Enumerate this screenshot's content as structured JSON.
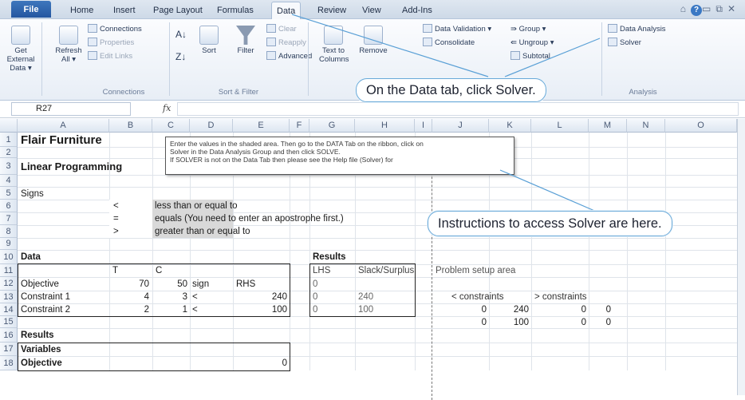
{
  "tabs": [
    "File",
    "Home",
    "Insert",
    "Page Layout",
    "Formulas",
    "Data",
    "Review",
    "View",
    "Add-Ins"
  ],
  "active_tab": "Data",
  "ribbon": {
    "get_external_data": "Get External Data ▾",
    "refresh_all": "Refresh All ▾",
    "connections": "Connections",
    "properties": "Properties",
    "edit_links": "Edit Links",
    "group_connections": "Connections",
    "sort": "Sort",
    "filter": "Filter",
    "clear": "Clear",
    "reapply": "Reapply",
    "advanced": "Advanced",
    "group_sort_filter": "Sort & Filter",
    "text_to_columns": "Text to Columns",
    "remove_duplicates": "Remove",
    "data_validation": "Data Validation ▾",
    "consolidate": "Consolidate",
    "group": "Group ▾",
    "ungroup": "Ungroup ▾",
    "subtotal": "Subtotal",
    "data_analysis": "Data Analysis",
    "solver": "Solver",
    "group_analysis": "Analysis"
  },
  "callouts": {
    "data_tab": "On the Data tab, click Solver.",
    "instructions": "Instructions to access Solver are here."
  },
  "formula_bar": {
    "name_box": "R27",
    "fx": "fx",
    "value": ""
  },
  "columns": [
    "A",
    "B",
    "C",
    "D",
    "E",
    "F",
    "G",
    "H",
    "I",
    "J",
    "K",
    "L",
    "M",
    "N",
    "O"
  ],
  "rows": [
    "1",
    "2",
    "3",
    "4",
    "5",
    "6",
    "7",
    "8",
    "9",
    "10",
    "11",
    "12",
    "13",
    "14",
    "15",
    "16",
    "17",
    "18"
  ],
  "sheet": {
    "title": "Flair Furniture",
    "subtitle": "Linear Programming",
    "signs": "Signs",
    "sign_lt": "<",
    "sign_eq": "=",
    "sign_gt": ">",
    "desc_lt": "less than or equal to",
    "desc_eq": "equals (You need to enter an apostrophe first.)",
    "desc_gt": "greater than or equal to",
    "data": "Data",
    "hdr_t": "T",
    "hdr_c": "C",
    "objective": "Objective",
    "constraint1": "Constraint 1",
    "constraint2": "Constraint 2",
    "obj_t": "70",
    "obj_c": "50",
    "sign_col": "sign",
    "rhs": "RHS",
    "c1_t": "4",
    "c1_c": "3",
    "c1_sign": "<",
    "c1_rhs": "240",
    "c2_t": "2",
    "c2_c": "1",
    "c2_sign": "<",
    "c2_rhs": "100",
    "results_hdr": "Results",
    "lhs": "LHS",
    "slack": "Slack/Surplus",
    "g12": "0",
    "g13": "0",
    "h13": "240",
    "g14": "0",
    "h14": "100",
    "setup": "Problem setup area",
    "lt_constraints": "< constraints",
    "gt_constraints": "> constraints",
    "j13": "0",
    "k13": "240",
    "l13": "0",
    "m13": "0",
    "j14": "0",
    "k14": "100",
    "l14": "0",
    "m14": "0",
    "results": "Results",
    "variables": "Variables",
    "objective2": "Objective",
    "e18": "0"
  },
  "comment": {
    "line1": "Enter the values in the shaded area.  Then go to the DATA Tab on the ribbon, click on",
    "line2": "Solver in the Data Analysis Group and then click SOLVE.",
    "line3": "If SOLVER is not on the Data Tab then please see the Help file (Solver) for"
  }
}
